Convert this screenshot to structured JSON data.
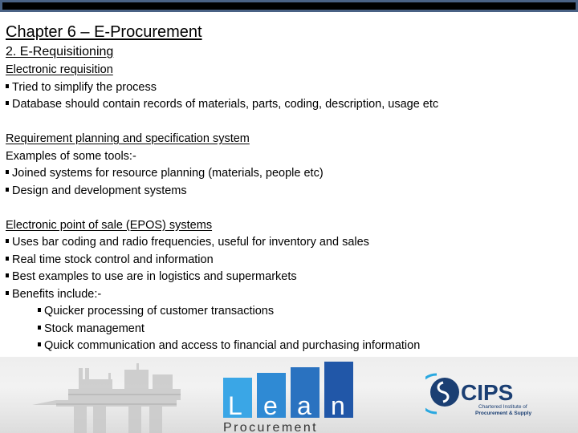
{
  "slide": {
    "title": "Chapter 6 – E-Procurement",
    "subtitle": "2. E-Requisitioning",
    "sections": [
      {
        "heading": "Electronic requisition",
        "bullets": [
          "Tried to simplify the process",
          "Database should contain records of materials, parts, coding, description, usage etc"
        ]
      },
      {
        "heading": "Requirement planning and specification system",
        "intro": "Examples of some tools:-",
        "bullets": [
          "Joined systems for resource planning (materials, people etc)",
          "Design and development systems"
        ]
      },
      {
        "heading": "Electronic point of sale (EPOS) systems",
        "bullets": [
          "Uses bar coding and radio frequencies, useful for inventory and sales",
          "Real time stock control and information",
          "Best examples to use are in logistics and supermarkets",
          "Benefits include:-"
        ],
        "sub_bullets": [
          "Quicker processing of customer transactions",
          "Stock management",
          "Quick communication and access to financial and purchasing information"
        ]
      }
    ]
  },
  "banner": {
    "lean_logo": {
      "letters": [
        "L",
        "e",
        "a",
        "n"
      ],
      "word": "Procurement",
      "colors": [
        "#3aa6e6",
        "#2f8ad4",
        "#2a72c0",
        "#2157a8"
      ]
    },
    "cips_logo": {
      "name": "CIPS",
      "tagline_1": "Chartered Institute of",
      "tagline_2": "Procurement & Supply",
      "color": "#1b3f73",
      "accent": "#29a8e0"
    }
  },
  "colors": {
    "topbar_border": "#4a6285",
    "topbar_fill": "#000000"
  }
}
